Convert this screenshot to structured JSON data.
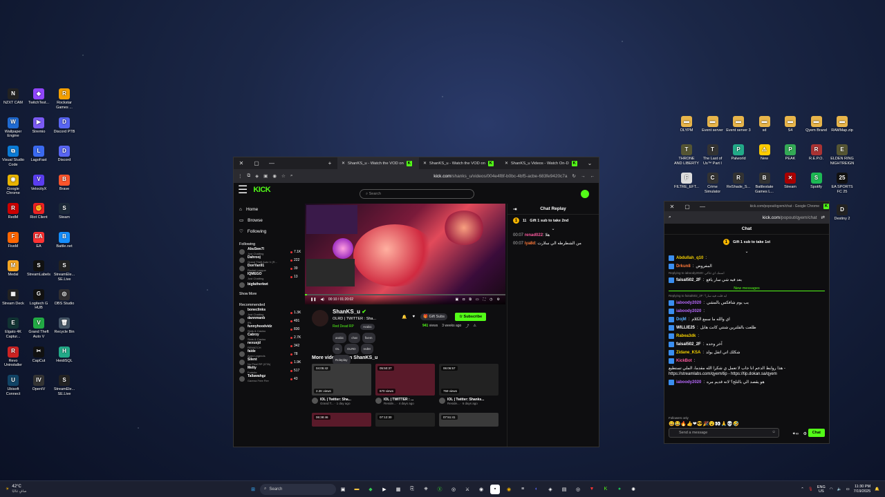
{
  "desktop": {
    "left_icons": [
      {
        "label": "NZXT CAM",
        "color": "#222",
        "glyph": "N"
      },
      {
        "label": "TwitchTest...",
        "color": "#9146ff",
        "glyph": "◆"
      },
      {
        "label": "Rockstar Games ...",
        "color": "#f5a000",
        "glyph": "R"
      },
      {
        "label": "Wallpaper Engine",
        "color": "#1f6ad1",
        "glyph": "W"
      },
      {
        "label": "Stremio",
        "color": "#7b5bf5",
        "glyph": "▶"
      },
      {
        "label": "Discord PTB",
        "color": "#5865f2",
        "glyph": "D"
      },
      {
        "label": "Visual Studio Code",
        "color": "#0a7bd6",
        "glyph": "⧉"
      },
      {
        "label": "LagoFast",
        "color": "#3a6af0",
        "glyph": "L"
      },
      {
        "label": "Discord",
        "color": "#5865f2",
        "glyph": "D"
      },
      {
        "label": "Google Chrome",
        "color": "#e8b400",
        "glyph": "◉"
      },
      {
        "label": "VelocityX",
        "color": "#5a3df0",
        "glyph": "V"
      },
      {
        "label": "Brave",
        "color": "#fb542b",
        "glyph": "B"
      },
      {
        "label": "RedM",
        "color": "#c00",
        "glyph": "R"
      },
      {
        "label": "Riot Client",
        "color": "#e22",
        "glyph": "✊"
      },
      {
        "label": "Steam",
        "color": "#1b2838",
        "glyph": "S"
      },
      {
        "label": "FiveM",
        "color": "#f60",
        "glyph": "F"
      },
      {
        "label": "EA",
        "color": "#f33",
        "glyph": "EA"
      },
      {
        "label": "Battle.net",
        "color": "#148eff",
        "glyph": "B"
      },
      {
        "label": "Medal",
        "color": "#f5a623",
        "glyph": "M"
      },
      {
        "label": "StreamLabels",
        "color": "#111",
        "glyph": "S"
      },
      {
        "label": "StreamEle... SE.Live",
        "color": "#222",
        "glyph": "S"
      },
      {
        "label": "Stream Deck",
        "color": "#222",
        "glyph": "▦"
      },
      {
        "label": "Logitech G HUB",
        "color": "#111",
        "glyph": "G"
      },
      {
        "label": "OBS Studio",
        "color": "#302e31",
        "glyph": "◎"
      },
      {
        "label": "Elgato 4K Captur...",
        "color": "#133",
        "glyph": "E"
      },
      {
        "label": "Grand Theft Auto V",
        "color": "#2a4",
        "glyph": "V"
      },
      {
        "label": "Recycle Bin",
        "color": "#456",
        "glyph": "🗑"
      },
      {
        "label": "Revo Uninstaller",
        "color": "#c22",
        "glyph": "R"
      },
      {
        "label": "CapCut",
        "color": "#111",
        "glyph": "✂"
      },
      {
        "label": "HeidiSQL",
        "color": "#2a8",
        "glyph": "H"
      },
      {
        "label": "Ubisoft Connect",
        "color": "#146",
        "glyph": "U"
      },
      {
        "label": "OpenIV",
        "color": "#333",
        "glyph": "IV"
      },
      {
        "label": "StreamEle... SE.Live",
        "color": "#222",
        "glyph": "S"
      }
    ],
    "right_icons": [
      {
        "label": "OLYPM",
        "color": "#e8b54a",
        "glyph": "▬"
      },
      {
        "label": "Event server",
        "color": "#e8b54a",
        "glyph": "▬"
      },
      {
        "label": "Event server 3",
        "color": "#e8b54a",
        "glyph": "▬"
      },
      {
        "label": "sd",
        "color": "#e8b54a",
        "glyph": "▬"
      },
      {
        "label": "S4",
        "color": "#e8b54a",
        "glyph": "▬"
      },
      {
        "label": "Qyem Brand",
        "color": "#e8b54a",
        "glyph": "▬"
      },
      {
        "label": "RAMMap.zip",
        "color": "#e8b54a",
        "glyph": "▬"
      },
      {
        "label": "THRONE AND LIBERTY",
        "color": "#553",
        "glyph": "T"
      },
      {
        "label": "The Last of Us™ Part I",
        "color": "#333",
        "glyph": "T"
      },
      {
        "label": "Palworld",
        "color": "#2a8",
        "glyph": "P"
      },
      {
        "label": "New",
        "color": "#fc0",
        "glyph": "⚠"
      },
      {
        "label": "PEAK",
        "color": "#3a5",
        "glyph": "P"
      },
      {
        "label": "R.E.P.O.",
        "color": "#a33",
        "glyph": "R"
      },
      {
        "label": "ELDEN RING NIGHTREIGN",
        "color": "#553",
        "glyph": "E"
      },
      {
        "label": "FILTRE_EFT...",
        "color": "#ddd",
        "glyph": "F"
      },
      {
        "label": "Crime Simulator",
        "color": "#333",
        "glyph": "C"
      },
      {
        "label": "ReShade_S...",
        "color": "#333",
        "glyph": "R"
      },
      {
        "label": "Battlestate Games L...",
        "color": "#333",
        "glyph": "B"
      },
      {
        "label": "Stream",
        "color": "#a00",
        "glyph": "✕"
      },
      {
        "label": "Spotify",
        "color": "#1db954",
        "glyph": "S"
      },
      {
        "label": "EA SPORTS FC 25",
        "color": "#111",
        "glyph": "25"
      }
    ],
    "destiny": "Destiny 2"
  },
  "browser": {
    "tabs": [
      "ShanKS_u - Watch the VOD on",
      "ShanKS_u - Watch the VOD on",
      "ShanKS_u Videos - Watch On-D"
    ],
    "url_domain": "kick.com",
    "url_path": "/shanks_u/videos/004e4f8f-b0bc-4bf5-acbe-683fe9420c7a",
    "search_placeholder": "Search",
    "logo": "KICK",
    "nav": [
      "Home",
      "Browse",
      "Following"
    ],
    "following_head": "Following",
    "following": [
      {
        "name": "AbuSwe7l",
        "game": "Just Chatting",
        "viewers": "7.1K"
      },
      {
        "name": "Dahrooj",
        "game": "Grand Theft Auto V (R...",
        "viewers": "222"
      },
      {
        "name": "DonYan91",
        "game": "Rocket League",
        "viewers": "39"
      },
      {
        "name": "IQMEGO",
        "game": "Just Chatting",
        "viewers": "13"
      },
      {
        "name": "bigfatherkwt",
        "game": "",
        "viewers": ""
      }
    ],
    "show_more": "Show More",
    "recommended_head": "Recommended",
    "recommended": [
      {
        "name": "boneclinks",
        "game": "Just Chatting",
        "viewers": "1.3K"
      },
      {
        "name": "dannmanb",
        "game": "IRL",
        "viewers": "491"
      },
      {
        "name": "funnyhoodvidz",
        "game": "Slots & Casino",
        "viewers": "830"
      },
      {
        "name": "Cabrzy",
        "game": "Slots & Casino",
        "viewers": "2.7K"
      },
      {
        "name": "nexusjd",
        "game": "REMATCH",
        "viewers": "342"
      },
      {
        "name": "faide",
        "game": "Apex Legends",
        "viewers": "78"
      },
      {
        "name": "Silent",
        "game": "No Pixel RP (GTA)",
        "viewers": "1.9K"
      },
      {
        "name": "Melty",
        "game": "Fortnite",
        "viewers": "517"
      },
      {
        "name": "Tallawahgz",
        "game": "Garena Free Fire",
        "viewers": "43"
      }
    ],
    "player_time": "00:10 / 01:20:02",
    "player_progress": 0.01,
    "channel": "ShanKS_u",
    "stream_title": "OLRD | TWITTER : Sha...",
    "category": "Red Dead RP",
    "language": "Arabic",
    "tags": [
      "arabic",
      "chat",
      "fivem",
      "OL",
      "OLRD",
      "redM",
      "Roleplay"
    ],
    "views": "941",
    "views_label": "views",
    "ago": "3 weeks ago",
    "gift_label": "Gift Subs",
    "subscribe_label": "Subscribe",
    "more_videos": "More videos from ShanKS_u",
    "videos": [
      {
        "dur": "04:05:42",
        "views": "2.2K views",
        "title": "IOL | Twitter: Sha...",
        "meta": "Grand T... · 1 day ago"
      },
      {
        "dur": "05:50:37",
        "views": "670 views",
        "title": "IOL | TWITTER : ...",
        "meta": "Reside... · 4 days ago"
      },
      {
        "dur": "06:06:57",
        "views": "759 views",
        "title": "IOL | Twitter: Shanks...",
        "meta": "Reside... · 6 days ago"
      }
    ],
    "videos_row2": [
      "06:38:46",
      "07:12:30",
      "07:51:41"
    ],
    "chat_title": "Chat Replay",
    "gift_count": "11",
    "gift_text": "Gift 1 sub to take 2nd",
    "chat": [
      {
        "time": "00:07",
        "user": "renad022",
        "text": "هلا",
        "color": "#ff5aa0"
      },
      {
        "time": "00:07",
        "user": "iya8d",
        "text": "من الشطرطه الي سلارت",
        "color": "#ff7a3a"
      }
    ]
  },
  "popout": {
    "url_domain": "kick.com",
    "url_path": "/popout/qyem/chat",
    "window_title": "kick.com/popout/qyem/chat - Google Chrome",
    "header": "Chat",
    "gift_text": "Gift 1 sub to take 1st",
    "new_messages": "New messages",
    "messages": [
      {
        "user": "Abdullah_q10",
        "text": "",
        "color": "#f5d000"
      },
      {
        "user": "Drkun8",
        "text": "المفروض",
        "color": "#ff7a3a"
      },
      {
        "reply": "Replying to iaboody2020: اسمك اي تتاكي",
        "user": "faisal502_2F",
        "text": "بعد فيه شي سار يافع",
        "color": "#fff"
      },
      {
        "reply": "Replying to faisal502_2F: ابه قلت فيه سار؟",
        "user": "iaboody2020",
        "text": "يب يوم شافكس بالمشي",
        "color": "#b96aff"
      },
      {
        "user": "iaboody2020",
        "text": "",
        "color": "#b96aff"
      },
      {
        "user": "DojM",
        "text": "اي والله ما سمع الكلام",
        "color": "#5ab0ff"
      },
      {
        "user": "WILLIE25",
        "text": "طلعت بالفلترين شتتي كانت هايل",
        "color": "#fff"
      },
      {
        "user": "Rabea3dk",
        "text": "",
        "color": "#f5d000"
      },
      {
        "user": "faisal502_2F",
        "text": "آخر وحده",
        "color": "#fff"
      },
      {
        "user": "Zidane_KSA",
        "text": "شكلك اتي اتقل يولد",
        "color": "#f5d000"
      },
      {
        "user": "KickBot",
        "text": "هذا روابط الدعم انا جاب لا تعمل ي شكرا الله مقدما، الملي تستطيع - https://streamlabs.com/qyem/tip - https://tip.dokan.sa/qyem",
        "color": "#ff5aa0"
      },
      {
        "user": "iaboody2020",
        "text": "هو يقصد الي بالثلج؟ لانه قديم مره",
        "color": "#b96aff"
      }
    ],
    "followers_only": "Followers only",
    "send_placeholder": "Send a message",
    "chat_button": "Chat"
  },
  "taskbar": {
    "weather": "42°C",
    "weather_sub": "صافٍ غالبًا",
    "search": "Search",
    "lang": "ENG",
    "region": "US",
    "time": "11:30 PM",
    "date": "7/19/2025"
  }
}
